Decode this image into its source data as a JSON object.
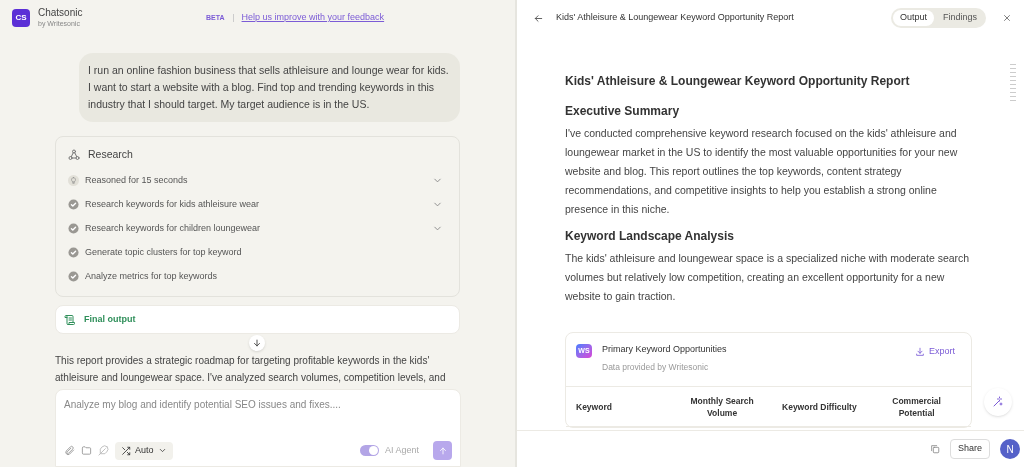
{
  "app": {
    "name": "Chatsonic",
    "byline": "by Writesonic",
    "logo": "CS",
    "beta": "BETA",
    "feedback_link": "Help us improve with your feedback"
  },
  "chat": {
    "user_message": "I run an online fashion business that sells athleisure and lounge wear for kids. I want to start a website with a blog. Find top and trending keywords in this industry that I should target. My target audience is in the US.",
    "research": {
      "title": "Research",
      "steps": [
        {
          "kind": "reasoning",
          "label": "Reasoned for 15 seconds",
          "expandable": true
        },
        {
          "kind": "done",
          "label": "Research keywords for kids athleisure wear",
          "expandable": true
        },
        {
          "kind": "done",
          "label": "Research keywords for children loungewear",
          "expandable": true
        },
        {
          "kind": "done",
          "label": "Generate topic clusters for top keyword",
          "expandable": false
        },
        {
          "kind": "done",
          "label": "Analyze metrics for top keywords",
          "expandable": false
        }
      ]
    },
    "final_output": "Final output",
    "response_lines": [
      "This report provides a strategic roadmap for targeting profitable keywords in the kids'",
      "athleisure and loungewear space. I've analyzed search volumes, competition levels, and"
    ],
    "composer": {
      "placeholder": "Analyze my blog and identify potential SEO issues and fixes....",
      "mode": "Auto",
      "agent_label": "AI Agent",
      "agent_on": true
    }
  },
  "report": {
    "title": "Kids' Athleisure & Loungewear Keyword Opportunity Report",
    "tabs": [
      {
        "label": "Output",
        "selected": true
      },
      {
        "label": "Findings",
        "selected": false
      }
    ],
    "heading": "Kids' Athleisure & Loungewear Keyword Opportunity Report",
    "sections": [
      {
        "heading": "Executive Summary",
        "body": "I've conducted comprehensive keyword research focused on the kids' athleisure and loungewear market in the US to identify the most valuable opportunities for your new website and blog. This report outlines the top keywords, content strategy recommendations, and competitive insights to help you establish a strong online presence in this niche."
      },
      {
        "heading": "Keyword Landscape Analysis",
        "body": "The kids' athleisure and loungewear space is a specialized niche with moderate search volumes but relatively low competition, creating an excellent opportunity for a new website to gain traction."
      }
    ],
    "table": {
      "logo": "WS",
      "title": "Primary Keyword Opportunities",
      "subtitle": "Data provided by Writesonic",
      "export": "Export",
      "columns": [
        "Keyword",
        "Monthly Search Volume",
        "Keyword Difficulty",
        "Commercial Potential"
      ]
    },
    "share": "Share",
    "avatar": "N"
  }
}
